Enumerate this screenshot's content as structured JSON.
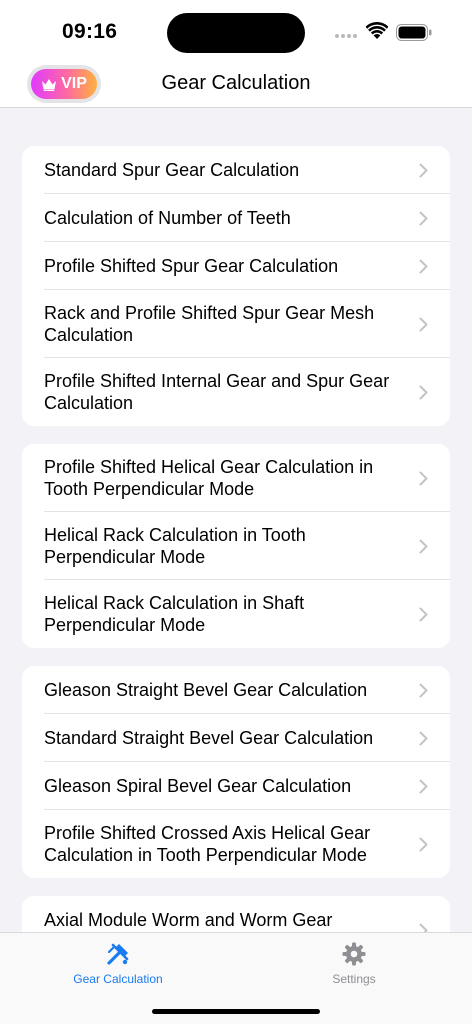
{
  "status_bar": {
    "time": "09:16"
  },
  "nav": {
    "vip_label": "VIP",
    "title": "Gear Calculation"
  },
  "groups": [
    {
      "rows": [
        {
          "label": "Standard Spur Gear Calculation"
        },
        {
          "label": "Calculation of Number of Teeth"
        },
        {
          "label": "Profile Shifted Spur Gear Calculation"
        },
        {
          "label": "Rack and Profile Shifted Spur Gear Mesh Calculation"
        },
        {
          "label": "Profile Shifted Internal Gear and Spur Gear Calculation"
        }
      ]
    },
    {
      "rows": [
        {
          "label": "Profile Shifted Helical Gear Calculation in Tooth Perpendicular Mode"
        },
        {
          "label": "Helical Rack Calculation in Tooth Perpendicular Mode"
        },
        {
          "label": "Helical Rack Calculation in Shaft Perpendicular Mode"
        }
      ]
    },
    {
      "rows": [
        {
          "label": "Gleason Straight Bevel Gear Calculation"
        },
        {
          "label": "Standard Straight Bevel Gear Calculation"
        },
        {
          "label": "Gleason Spiral Bevel Gear Calculation"
        },
        {
          "label": "Profile Shifted Crossed Axis Helical Gear Calculation in Tooth Perpendicular Mode"
        }
      ]
    },
    {
      "rows": [
        {
          "label": "Axial Module Worm and Worm Gear"
        }
      ]
    }
  ],
  "tab_bar": {
    "tabs": [
      {
        "label": "Gear Calculation",
        "icon": "gear-calculation-icon",
        "active": true
      },
      {
        "label": "Settings",
        "icon": "gear-icon",
        "active": false
      }
    ]
  },
  "colors": {
    "accent": "#1a7cf0",
    "inactive": "#8e8e93",
    "background": "#f2f2f7"
  }
}
